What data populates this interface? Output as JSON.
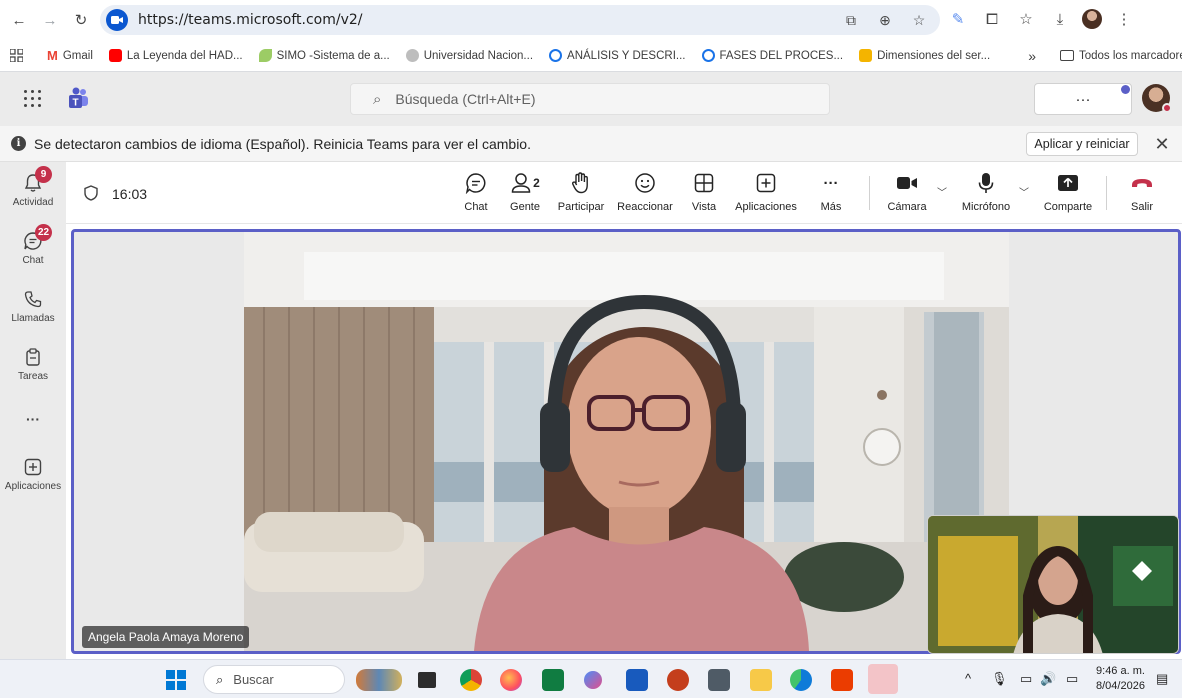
{
  "browser": {
    "url": "https://teams.microsoft.com/v2/",
    "icons": [
      "back-icon",
      "forward-icon",
      "reload-icon",
      "site-info-icon",
      "install-app-icon",
      "zoom-icon",
      "bookmark-star-icon",
      "extension-icon",
      "puzzle-icon",
      "bookmarks-icon",
      "download-icon",
      "profile-avatar",
      "menu-icon"
    ]
  },
  "bookmarks": {
    "items": [
      {
        "label": "Gmail",
        "color": "#ea4335"
      },
      {
        "label": "La Leyenda del HAD...",
        "color": "#ff0000"
      },
      {
        "label": "SIMO -Sistema de a...",
        "color": "#7cb342"
      },
      {
        "label": "Universidad Nacion...",
        "color": "#9e9e9e"
      },
      {
        "label": "ANÁLISIS Y DESCRI...",
        "color": "#1a73e8"
      },
      {
        "label": "FASES DEL PROCES...",
        "color": "#1a73e8"
      },
      {
        "label": "Dimensiones del ser...",
        "color": "#f4b400"
      }
    ],
    "overflow": "»",
    "all_bookmarks": "Todos los marcadores"
  },
  "teams": {
    "search_placeholder": "Búsqueda (Ctrl+Alt+E)",
    "more": "···",
    "accent": "#5b5fc7"
  },
  "notification": {
    "text": "Se detectaron cambios de idioma (Español). Reinicia Teams para ver el cambio.",
    "apply": "Aplicar y reiniciar",
    "close": "✕"
  },
  "rail": {
    "items": [
      {
        "label": "Actividad",
        "badge": "9"
      },
      {
        "label": "Chat",
        "badge": "22"
      },
      {
        "label": "Llamadas",
        "badge": ""
      },
      {
        "label": "Tareas",
        "badge": ""
      },
      {
        "label": "···",
        "badge": ""
      },
      {
        "label": "Aplicaciones",
        "badge": ""
      }
    ]
  },
  "meeting": {
    "timer": "16:03",
    "people_count": "2",
    "controls": {
      "chat": "Chat",
      "people": "Gente",
      "raise": "Participar",
      "react": "Reaccionar",
      "view": "Vista",
      "apps": "Aplicaciones",
      "more": "Más",
      "camera": "Cámara",
      "mic": "Micrófono",
      "share": "Comparte",
      "leave": "Salir"
    },
    "leave_color": "#c4314b",
    "participant_name": "Angela Paola Amaya Moreno"
  },
  "taskbar": {
    "search": "Buscar",
    "time": "9:46 a. m.",
    "date": "8/04/2026"
  }
}
